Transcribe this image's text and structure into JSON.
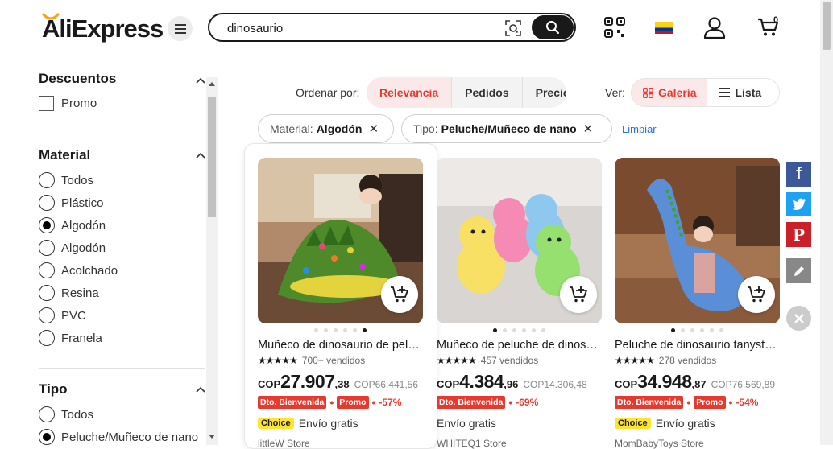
{
  "header": {
    "logo": {
      "prefix": "Ali",
      "suffix": "Express"
    },
    "search": {
      "value": "dinosaurio",
      "placeholder": ""
    },
    "cart_count": "0",
    "flag_colors": [
      "#fcd116",
      "#003893",
      "#ce1126"
    ]
  },
  "sidebar": {
    "descuentos": {
      "title": "Descuentos",
      "options": [
        "Promo"
      ]
    },
    "material": {
      "title": "Material",
      "options": [
        "Todos",
        "Plástico",
        "Algodón",
        "Algodón",
        "Acolchado",
        "Resina",
        "PVC",
        "Franela"
      ],
      "selected_index": 2
    },
    "tipo": {
      "title": "Tipo",
      "options": [
        "Todos",
        "Peluche/Muñeco de nano"
      ],
      "selected_index": 1
    }
  },
  "sort": {
    "label": "Ordenar por:",
    "options": [
      "Relevancia",
      "Pedidos",
      "Precio"
    ],
    "active": "Relevancia"
  },
  "view": {
    "label": "Ver:",
    "options": [
      "Galería",
      "Lista"
    ],
    "active": "Galería"
  },
  "filters": [
    {
      "key": "Material:",
      "value": "Algodón"
    },
    {
      "key": "Tipo:",
      "value": "Peluche/Muñeco de nano"
    }
  ],
  "clear_label": "Limpiar",
  "products": [
    {
      "title": "Muñeco de dinosaurio de peluche",
      "sold": "700+ vendidos",
      "currency": "COP",
      "price_int": "27.907",
      "price_dec": ",38",
      "orig": "COP66.441,56",
      "badge1": "Dto. Bienvenida",
      "badge2": "Promo",
      "discount": "-57%",
      "choice": "Choice",
      "shipping": "Envío gratis",
      "store": "littleW Store",
      "active_dot": 5
    },
    {
      "title": "Muñeco de peluche de dinosaurio",
      "sold": "457 vendidos",
      "currency": "COP",
      "price_int": "4.384",
      "price_dec": ",96",
      "orig": "COP14.306,48",
      "badge1": "Dto. Bienvenida",
      "badge2": "",
      "discount": "-69%",
      "choice": "",
      "shipping": "Envío gratis",
      "store": "WHITEQ1 Store",
      "active_dot": 0
    },
    {
      "title": "Peluche de dinosaurio tanystropheus",
      "sold": "278 vendidos",
      "currency": "COP",
      "price_int": "34.948",
      "price_dec": ",87",
      "orig": "COP76.569,89",
      "badge1": "Dto. Bienvenida",
      "badge2": "Promo",
      "discount": "-54%",
      "choice": "Choice",
      "shipping": "Envío gratis",
      "store": "MomBabyToys Store",
      "active_dot": 0
    }
  ],
  "social": [
    "facebook",
    "twitter",
    "pinterest",
    "edit"
  ],
  "colors": {
    "accent": "#e8392e",
    "facebook": "#3b5998",
    "twitter": "#1da1f2",
    "pinterest": "#cb2027",
    "edit": "#888888",
    "choice": "#fde433"
  }
}
